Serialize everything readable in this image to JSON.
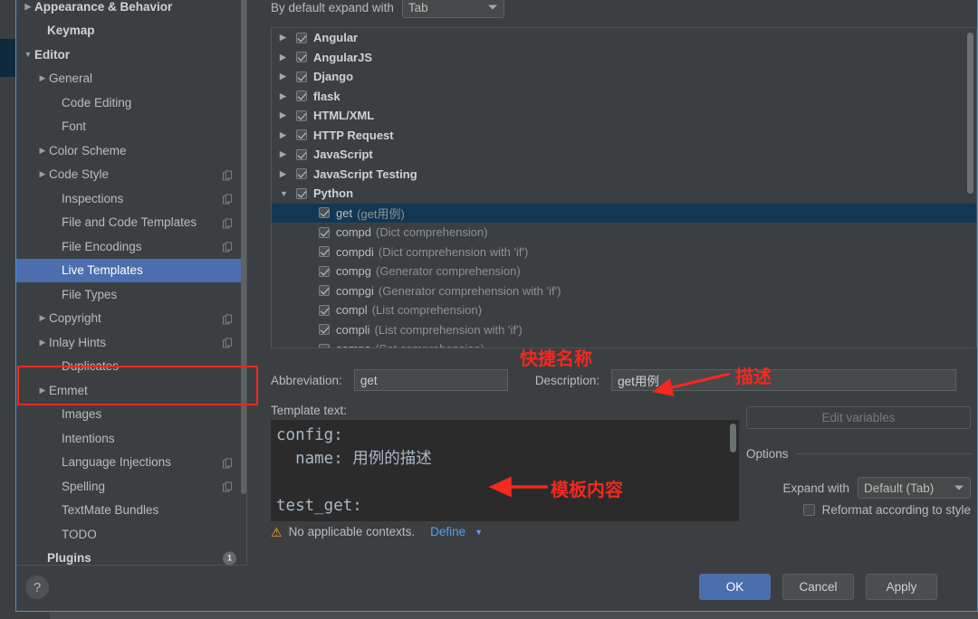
{
  "sidebar": {
    "items": [
      {
        "label": "Appearance & Behavior",
        "arrow": "▶",
        "indent": 20,
        "bold": true,
        "badge": null,
        "selected": false
      },
      {
        "label": "Keymap",
        "arrow": "",
        "indent": 34,
        "bold": true,
        "badge": null,
        "selected": false
      },
      {
        "label": "Editor",
        "arrow": "▼",
        "indent": 20,
        "bold": true,
        "badge": null,
        "selected": false
      },
      {
        "label": "General",
        "arrow": "▶",
        "indent": 36,
        "bold": false,
        "badge": null,
        "selected": false
      },
      {
        "label": "Code Editing",
        "arrow": "",
        "indent": 50,
        "bold": false,
        "badge": null,
        "selected": false
      },
      {
        "label": "Font",
        "arrow": "",
        "indent": 50,
        "bold": false,
        "badge": null,
        "selected": false
      },
      {
        "label": "Color Scheme",
        "arrow": "▶",
        "indent": 36,
        "bold": false,
        "badge": null,
        "selected": false
      },
      {
        "label": "Code Style",
        "arrow": "▶",
        "indent": 36,
        "bold": false,
        "badge": "copy",
        "selected": false
      },
      {
        "label": "Inspections",
        "arrow": "",
        "indent": 50,
        "bold": false,
        "badge": "copy",
        "selected": false
      },
      {
        "label": "File and Code Templates",
        "arrow": "",
        "indent": 50,
        "bold": false,
        "badge": "copy",
        "selected": false
      },
      {
        "label": "File Encodings",
        "arrow": "",
        "indent": 50,
        "bold": false,
        "badge": "copy",
        "selected": false
      },
      {
        "label": "Live Templates",
        "arrow": "",
        "indent": 50,
        "bold": false,
        "badge": null,
        "selected": true
      },
      {
        "label": "File Types",
        "arrow": "",
        "indent": 50,
        "bold": false,
        "badge": null,
        "selected": false
      },
      {
        "label": "Copyright",
        "arrow": "▶",
        "indent": 36,
        "bold": false,
        "badge": "copy",
        "selected": false
      },
      {
        "label": "Inlay Hints",
        "arrow": "▶",
        "indent": 36,
        "bold": false,
        "badge": "copy",
        "selected": false
      },
      {
        "label": "Duplicates",
        "arrow": "",
        "indent": 50,
        "bold": false,
        "badge": null,
        "selected": false
      },
      {
        "label": "Emmet",
        "arrow": "▶",
        "indent": 36,
        "bold": false,
        "badge": null,
        "selected": false
      },
      {
        "label": "Images",
        "arrow": "",
        "indent": 50,
        "bold": false,
        "badge": null,
        "selected": false
      },
      {
        "label": "Intentions",
        "arrow": "",
        "indent": 50,
        "bold": false,
        "badge": null,
        "selected": false
      },
      {
        "label": "Language Injections",
        "arrow": "",
        "indent": 50,
        "bold": false,
        "badge": "copy",
        "selected": false
      },
      {
        "label": "Spelling",
        "arrow": "",
        "indent": 50,
        "bold": false,
        "badge": "copy",
        "selected": false
      },
      {
        "label": "TextMate Bundles",
        "arrow": "",
        "indent": 50,
        "bold": false,
        "badge": null,
        "selected": false
      },
      {
        "label": "TODO",
        "arrow": "",
        "indent": 50,
        "bold": false,
        "badge": null,
        "selected": false
      },
      {
        "label": "Plugins",
        "arrow": "",
        "indent": 34,
        "bold": true,
        "badge": "1",
        "selected": false
      }
    ]
  },
  "main": {
    "expand_with_label": "By default expand with",
    "expand_with_value": "Tab",
    "tree": {
      "groups": [
        {
          "label": "Angular",
          "arrow": "▶",
          "checked": true
        },
        {
          "label": "AngularJS",
          "arrow": "▶",
          "checked": true
        },
        {
          "label": "Django",
          "arrow": "▶",
          "checked": true
        },
        {
          "label": "flask",
          "arrow": "▶",
          "checked": true
        },
        {
          "label": "HTML/XML",
          "arrow": "▶",
          "checked": true
        },
        {
          "label": "HTTP Request",
          "arrow": "▶",
          "checked": true
        },
        {
          "label": "JavaScript",
          "arrow": "▶",
          "checked": true
        },
        {
          "label": "JavaScript Testing",
          "arrow": "▶",
          "checked": true
        },
        {
          "label": "Python",
          "arrow": "▼",
          "checked": true
        }
      ],
      "children": [
        {
          "abbrev": "get",
          "desc": "(get用例)",
          "checked": true,
          "selected": true
        },
        {
          "abbrev": "compd",
          "desc": "(Dict comprehension)",
          "checked": true,
          "selected": false
        },
        {
          "abbrev": "compdi",
          "desc": "(Dict comprehension with 'if')",
          "checked": true,
          "selected": false
        },
        {
          "abbrev": "compg",
          "desc": "(Generator comprehension)",
          "checked": true,
          "selected": false
        },
        {
          "abbrev": "compgi",
          "desc": "(Generator comprehension with 'if')",
          "checked": true,
          "selected": false
        },
        {
          "abbrev": "compl",
          "desc": "(List comprehension)",
          "checked": true,
          "selected": false
        },
        {
          "abbrev": "compli",
          "desc": "(List comprehension with 'if')",
          "checked": true,
          "selected": false
        },
        {
          "abbrev": "comps",
          "desc": "(Set comprehension)",
          "checked": true,
          "selected": false
        }
      ]
    },
    "toolbar": {
      "add": "+",
      "remove": "−",
      "duplicate": "❏",
      "revert": "↺"
    },
    "abbreviation_label": "Abbreviation:",
    "abbreviation_value": "get",
    "description_label": "Description:",
    "description_value": "get用例",
    "template_text_label": "Template text:",
    "template_text_value": "config:\n  name: 用例的描述\n\ntest_get:",
    "context_warning": "No applicable contexts.",
    "define_link": "Define",
    "edit_variables_label": "Edit variables",
    "options_label": "Options",
    "expand_with_option_label": "Expand with",
    "expand_with_option_value": "Default (Tab)",
    "reformat_label": "Reformat according to style"
  },
  "annotations": {
    "abbrev_note": "快捷名称",
    "desc_note": "描述",
    "template_note": "模板内容",
    "color": "#f3281e"
  },
  "footer": {
    "help": "?",
    "ok": "OK",
    "cancel": "Cancel",
    "apply": "Apply"
  }
}
